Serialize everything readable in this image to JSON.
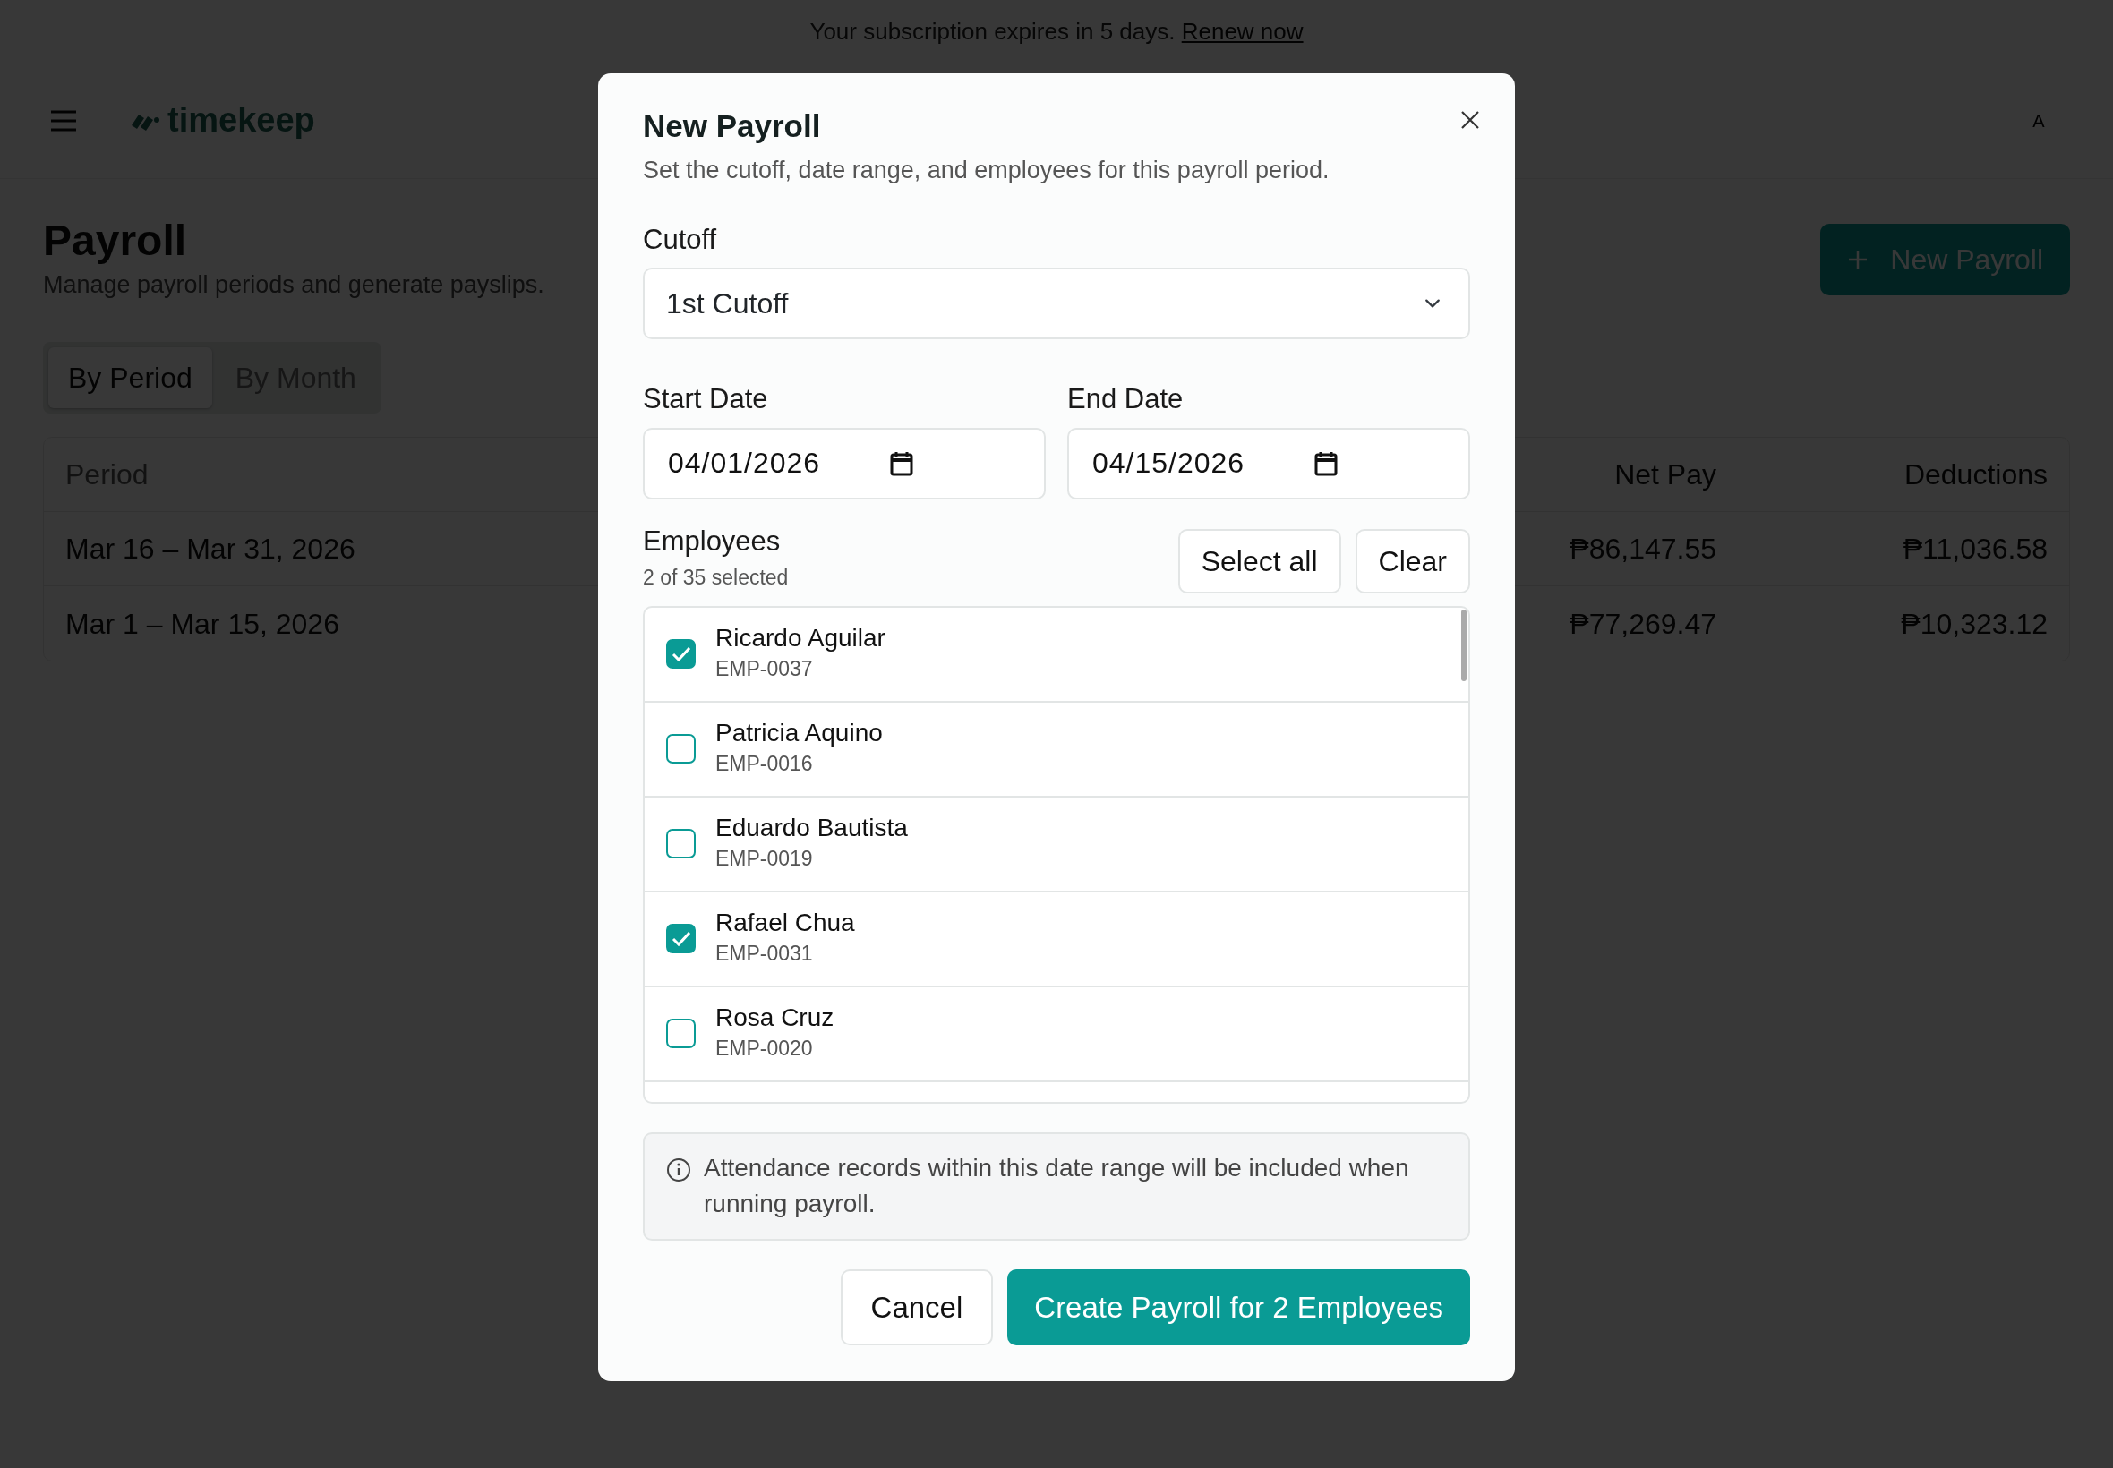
{
  "banner": {
    "text": "Your subscription expires in 5 days.",
    "link": "Renew now"
  },
  "header": {
    "logo": "timekeep",
    "avatar": "A"
  },
  "page": {
    "title": "Payroll",
    "subtitle": "Manage payroll periods and generate payslips.",
    "new_button": "New Payroll"
  },
  "view_tabs": [
    {
      "label": "By Period",
      "selected": true
    },
    {
      "label": "By Month",
      "selected": false
    }
  ],
  "table": {
    "columns": [
      "Period",
      "Net Pay",
      "Deductions"
    ],
    "rows": [
      {
        "period": "Mar 16 – Mar 31, 2026",
        "net_pay": "₱86,147.55",
        "deductions": "₱11,036.58"
      },
      {
        "period": "Mar 1 – Mar 15, 2026",
        "net_pay": "₱77,269.47",
        "deductions": "₱10,323.12"
      }
    ]
  },
  "modal": {
    "title": "New Payroll",
    "subtitle": "Set the cutoff, date range, and employees for this payroll period.",
    "cutoff": {
      "label": "Cutoff",
      "value": "1st Cutoff"
    },
    "start_date": {
      "label": "Start Date",
      "value": "04/01/2026"
    },
    "end_date": {
      "label": "End Date",
      "value": "04/15/2026"
    },
    "employees": {
      "label": "Employees",
      "count": "2 of 35 selected",
      "select_all": "Select all",
      "clear": "Clear",
      "list": [
        {
          "name": "Ricardo Aguilar",
          "id": "EMP-0037",
          "checked": true
        },
        {
          "name": "Patricia Aquino",
          "id": "EMP-0016",
          "checked": false
        },
        {
          "name": "Eduardo Bautista",
          "id": "EMP-0019",
          "checked": false
        },
        {
          "name": "Rafael Chua",
          "id": "EMP-0031",
          "checked": true
        },
        {
          "name": "Rosa Cruz",
          "id": "EMP-0020",
          "checked": false
        }
      ]
    },
    "info": "Attendance records within this date range will be included when running payroll.",
    "cancel": "Cancel",
    "submit": "Create Payroll for 2 Employees"
  }
}
